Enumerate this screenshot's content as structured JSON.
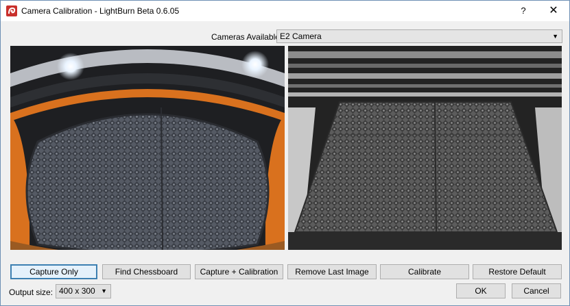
{
  "window": {
    "title": "Camera Calibration - LightBurn Beta 0.6.05",
    "help_glyph": "?",
    "close_glyph": "✕"
  },
  "camera": {
    "label": "Cameras Available:",
    "selected": "E2 Camera",
    "arrow": "▼"
  },
  "buttons": {
    "capture_only": "Capture Only",
    "find_chessboard": "Find Chessboard",
    "capture_calibration": "Capture + Calibration",
    "remove_last": "Remove Last Image",
    "calibrate": "Calibrate",
    "restore_default": "Restore Default",
    "ok": "OK",
    "cancel": "Cancel"
  },
  "output": {
    "label": "Output size:",
    "selected": "400 x 300",
    "arrow": "▼"
  },
  "colors": {
    "accent": "#3c7fb1",
    "brand": "#c9302c",
    "frame_orange": "#d9711e"
  },
  "icons": {
    "app": "lightburn-logo-icon",
    "help": "help-icon",
    "close": "close-icon"
  }
}
